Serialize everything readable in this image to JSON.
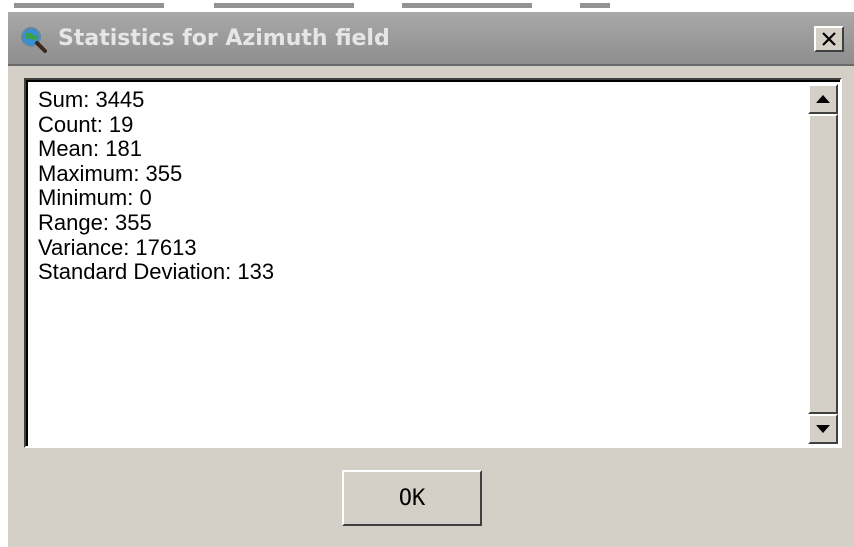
{
  "dialog": {
    "title": "Statistics for Azimuth field",
    "app_icon": "globe-magnifier-icon",
    "close_icon": "close-icon",
    "ok_label": "OK"
  },
  "statistics": {
    "lines": [
      "Sum: 3445",
      "Count: 19",
      "Mean: 181",
      "Maximum: 355",
      "Minimum: 0",
      "Range: 355",
      "Variance: 17613",
      "Standard Deviation: 133"
    ]
  },
  "scrollbar": {
    "up_icon": "arrow-up-icon",
    "down_icon": "arrow-down-icon"
  },
  "colors": {
    "dialog_face": "#d4d0c8",
    "titlebar_inactive": "#9a9a9a",
    "title_text": "#e6e6e6"
  }
}
